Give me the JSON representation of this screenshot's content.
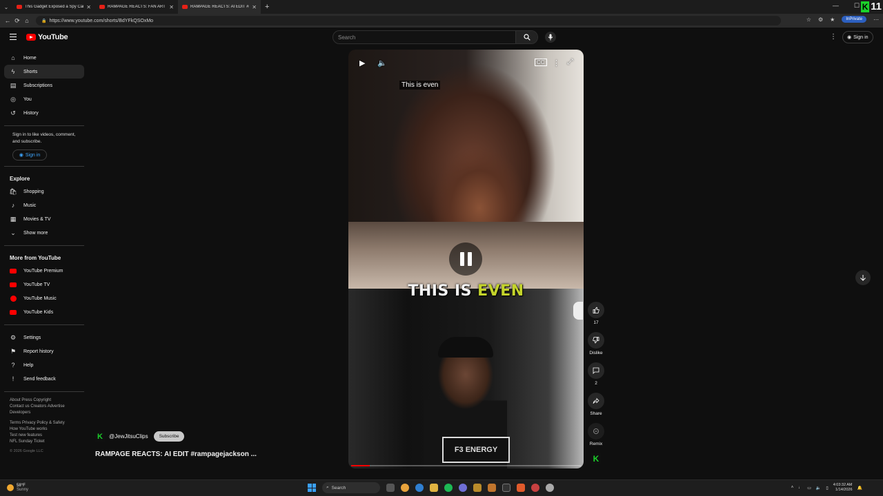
{
  "browser": {
    "tabs": [
      {
        "title": "This Gadget Exposed a Spy Camera",
        "active": false
      },
      {
        "title": "RAMPAGE REACTS: FAN ART #ram",
        "active": false
      },
      {
        "title": "RAMPAGE REACTS: AI EDIT #r",
        "active": true
      }
    ],
    "url": "https://www.youtube.com/shorts/BdYFkQSOxMo",
    "inprivate_label": "InPrivate",
    "badge_number": "11"
  },
  "header": {
    "logo_text": "YouTube",
    "search_placeholder": "Search",
    "signin_label": "Sign in"
  },
  "sidebar": {
    "main": [
      {
        "label": "Home",
        "icon": "home-icon"
      },
      {
        "label": "Shorts",
        "icon": "shorts-icon",
        "active": true
      },
      {
        "label": "Subscriptions",
        "icon": "subscriptions-icon"
      },
      {
        "label": "You",
        "icon": "you-icon"
      },
      {
        "label": "History",
        "icon": "history-icon"
      }
    ],
    "signin_note": "Sign in to like videos, comment, and subscribe.",
    "signin_button": "Sign in",
    "explore_heading": "Explore",
    "explore": [
      {
        "label": "Shopping",
        "icon": "shopping-icon"
      },
      {
        "label": "Music",
        "icon": "music-icon"
      },
      {
        "label": "Movies & TV",
        "icon": "movies-icon"
      },
      {
        "label": "Show more",
        "icon": "chevron-down-icon"
      }
    ],
    "more_heading": "More from YouTube",
    "more": [
      {
        "label": "YouTube Premium"
      },
      {
        "label": "YouTube TV"
      },
      {
        "label": "YouTube Music"
      },
      {
        "label": "YouTube Kids"
      }
    ],
    "settings": [
      {
        "label": "Settings",
        "icon": "gear-icon"
      },
      {
        "label": "Report history",
        "icon": "flag-icon"
      },
      {
        "label": "Help",
        "icon": "help-icon"
      },
      {
        "label": "Send feedback",
        "icon": "feedback-icon"
      }
    ],
    "footer_1": "About  Press  Copyright",
    "footer_2": "Contact us  Creators  Advertise",
    "footer_3": "Developers",
    "footer_4": "Terms  Privacy  Policy & Safety",
    "footer_5": "How YouTube works",
    "footer_6": "Test new features",
    "footer_7": "NFL Sunday Ticket",
    "copyright": "© 2026 Google LLC"
  },
  "player": {
    "cc_text": "This is even",
    "caption_white": "THIS IS ",
    "caption_highlight": "EVEN",
    "energy_text": "F3 ENERGY",
    "progress_fraction": 0.08
  },
  "channel": {
    "avatar_letter": "K",
    "handle": "@JewJitsuClips",
    "subscribe_label": "Subscribe",
    "video_title": "RAMPAGE REACTS: AI EDIT #rampagejackson ..."
  },
  "actions": {
    "like_count": "17",
    "dislike_label": "Dislike",
    "comment_count": "2",
    "share_label": "Share",
    "remix_label": "Remix"
  },
  "taskbar": {
    "temp": "58°F",
    "condition": "Sunny",
    "search_label": "Search",
    "time": "4:03:32 AM",
    "date": "1/14/2026"
  }
}
